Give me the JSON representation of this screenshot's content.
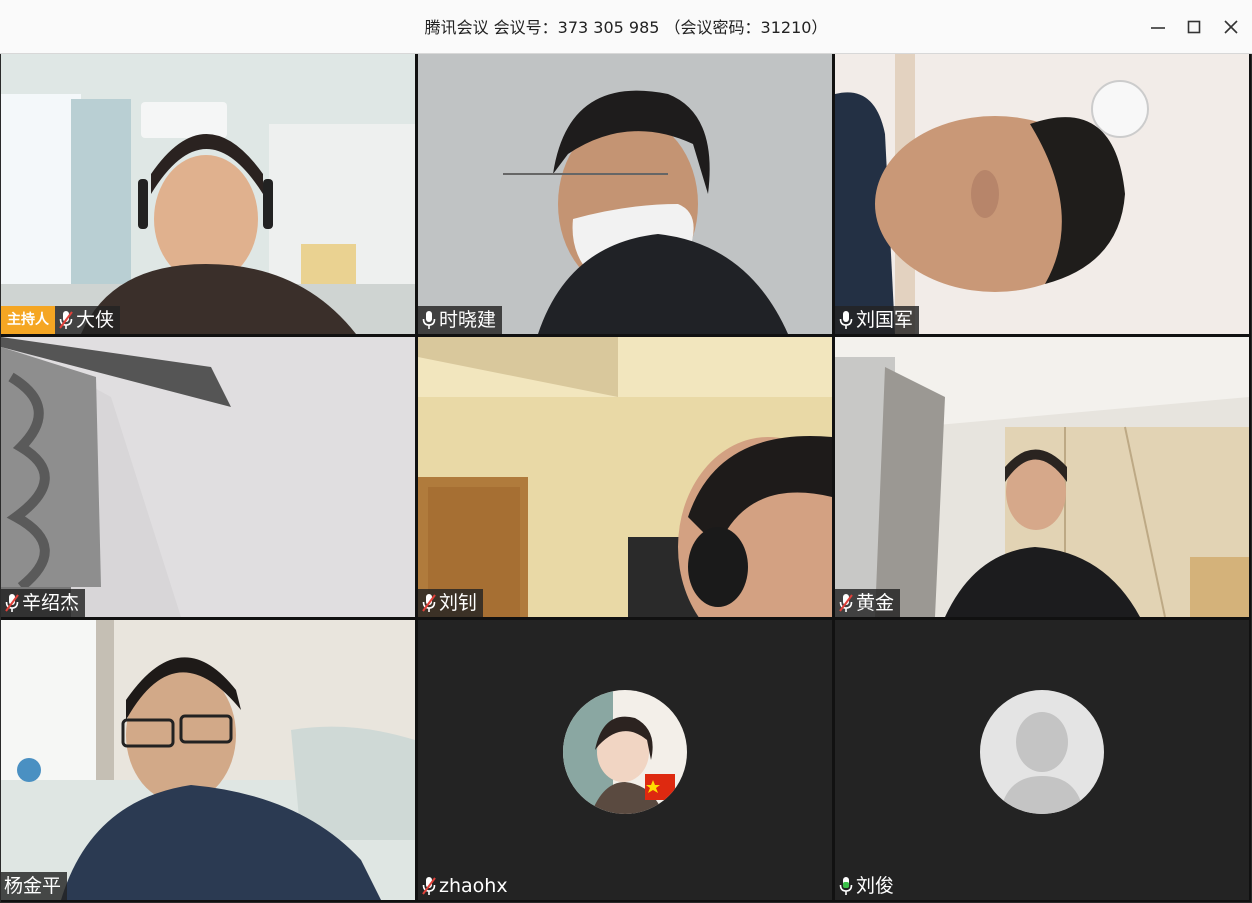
{
  "window": {
    "title": "腾讯会议 会议号：373 305 985 （会议密码：31210）",
    "controls": [
      "minimize-icon",
      "maximize-icon",
      "close-icon"
    ]
  },
  "participants": [
    {
      "name": "大侠",
      "host_badge": "主持人",
      "mic": "muted",
      "video": "camera"
    },
    {
      "name": "时晓建",
      "mic": "on",
      "video": "camera"
    },
    {
      "name": "刘国军",
      "mic": "on",
      "video": "camera"
    },
    {
      "name": "辛绍杰",
      "mic": "muted",
      "video": "camera"
    },
    {
      "name": "刘钊",
      "mic": "muted",
      "video": "camera"
    },
    {
      "name": "黄金",
      "mic": "muted",
      "video": "camera"
    },
    {
      "name": "杨金平",
      "mic": "none",
      "video": "camera"
    },
    {
      "name": "zhaohx",
      "mic": "muted",
      "video": "avatar-photo"
    },
    {
      "name": "刘俊",
      "mic": "speaking",
      "video": "avatar-default"
    }
  ],
  "colors": {
    "host_badge": "#f5a623",
    "mic_muted_slash": "#e0413a",
    "mic_speaking": "#3cc24a",
    "empty_tile_bg": "#232323"
  }
}
